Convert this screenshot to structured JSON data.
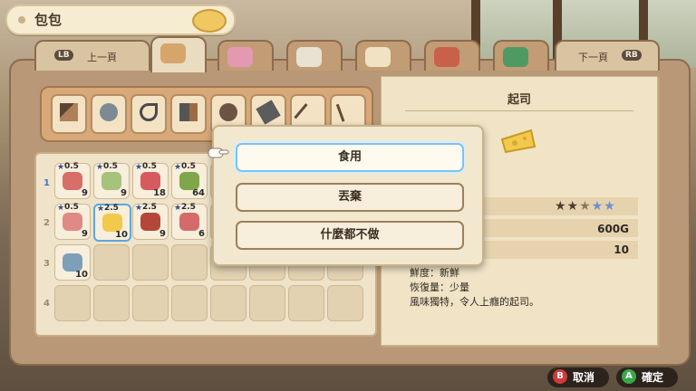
{
  "header": {
    "title": "包包"
  },
  "tabs": {
    "prev_button": "LB",
    "prev_label": "上一頁",
    "next_button": "RB",
    "next_label": "下一頁",
    "icons": [
      "tools-tab-icon",
      "flowers-tab-icon",
      "letters-tab-icon",
      "mail-tab-icon",
      "shop-tab-icon",
      "notebook-tab-icon"
    ],
    "active_index": 0
  },
  "toolbar": {
    "tools": [
      "hammer-icon",
      "watering-can-icon",
      "sickle-icon",
      "axe-icon",
      "brush-icon",
      "pipe-tool-icon",
      "tweezers-icon",
      "torch-icon"
    ]
  },
  "inventory": {
    "rows": [
      {
        "number": "1",
        "active": true
      },
      {
        "number": "2",
        "active": false
      },
      {
        "number": "3",
        "active": false
      },
      {
        "number": "4",
        "active": false
      }
    ],
    "items": [
      {
        "row": 0,
        "col": 0,
        "icon": "turnip-seed-bag-icon",
        "star": "0.5",
        "qty": "9",
        "color": "#d86e6a"
      },
      {
        "row": 0,
        "col": 1,
        "icon": "seed-packet-icon",
        "star": "0.5",
        "qty": "9",
        "color": "#a7c27c"
      },
      {
        "row": 0,
        "col": 2,
        "icon": "strawberry-seed-bag-icon",
        "star": "0.5",
        "qty": "18",
        "color": "#d65b61"
      },
      {
        "row": 0,
        "col": 3,
        "icon": "grass-icon",
        "star": "0.5",
        "qty": "64",
        "color": "#7fa64a"
      },
      {
        "row": 1,
        "col": 0,
        "icon": "turnip-seed-bag-icon",
        "star": "0.5",
        "qty": "9",
        "color": "#e08a86"
      },
      {
        "row": 1,
        "col": 1,
        "icon": "cheese-icon",
        "star": "2.5",
        "qty": "10",
        "color": "#f2c94c",
        "selected": true
      },
      {
        "row": 1,
        "col": 2,
        "icon": "jam-jar-icon",
        "star": "2.5",
        "qty": "9",
        "color": "#b5473a"
      },
      {
        "row": 1,
        "col": 3,
        "icon": "potion-bottle-icon",
        "star": "2.5",
        "qty": "6",
        "color": "#d46a6a"
      },
      {
        "row": 2,
        "col": 0,
        "icon": "material-box-icon",
        "star": "",
        "qty": "10",
        "color": "#7da0b8"
      }
    ]
  },
  "detail": {
    "title": "起司",
    "stars_on": "★★",
    "stars_half": "★",
    "stars_off": "★★",
    "price": "600G",
    "count": "10",
    "freshness": "鮮度：新鮮",
    "recovery": "恢復量：少量",
    "description": "風味獨特，令人上癮的起司。"
  },
  "popup": {
    "options": [
      "食用",
      "丟棄",
      "什麼都不做"
    ],
    "selected_index": 0
  },
  "footer": {
    "cancel_button": "B",
    "cancel_label": "取消",
    "confirm_button": "A",
    "confirm_label": "確定"
  },
  "colors": {
    "selected_border": "#7cc3ee",
    "cancel": "#d23b3b",
    "confirm": "#3aa84a"
  }
}
